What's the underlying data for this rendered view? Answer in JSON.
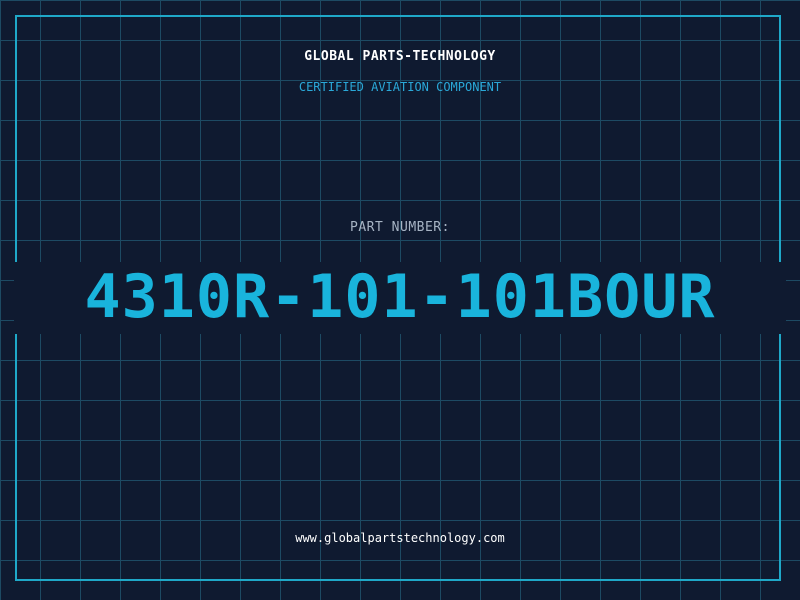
{
  "header": {
    "company": "GLOBAL PARTS-TECHNOLOGY",
    "subtitle": "CERTIFIED AVIATION COMPONENT"
  },
  "part": {
    "label": "PART NUMBER:",
    "number": "4310R-101-101BOUR"
  },
  "footer": {
    "website": "www.globalpartstechnology.com"
  },
  "colors": {
    "background": "#0f1a30",
    "grid": "#1d4a63",
    "accent": "#19b4dc",
    "border": "#1fa8c8"
  }
}
